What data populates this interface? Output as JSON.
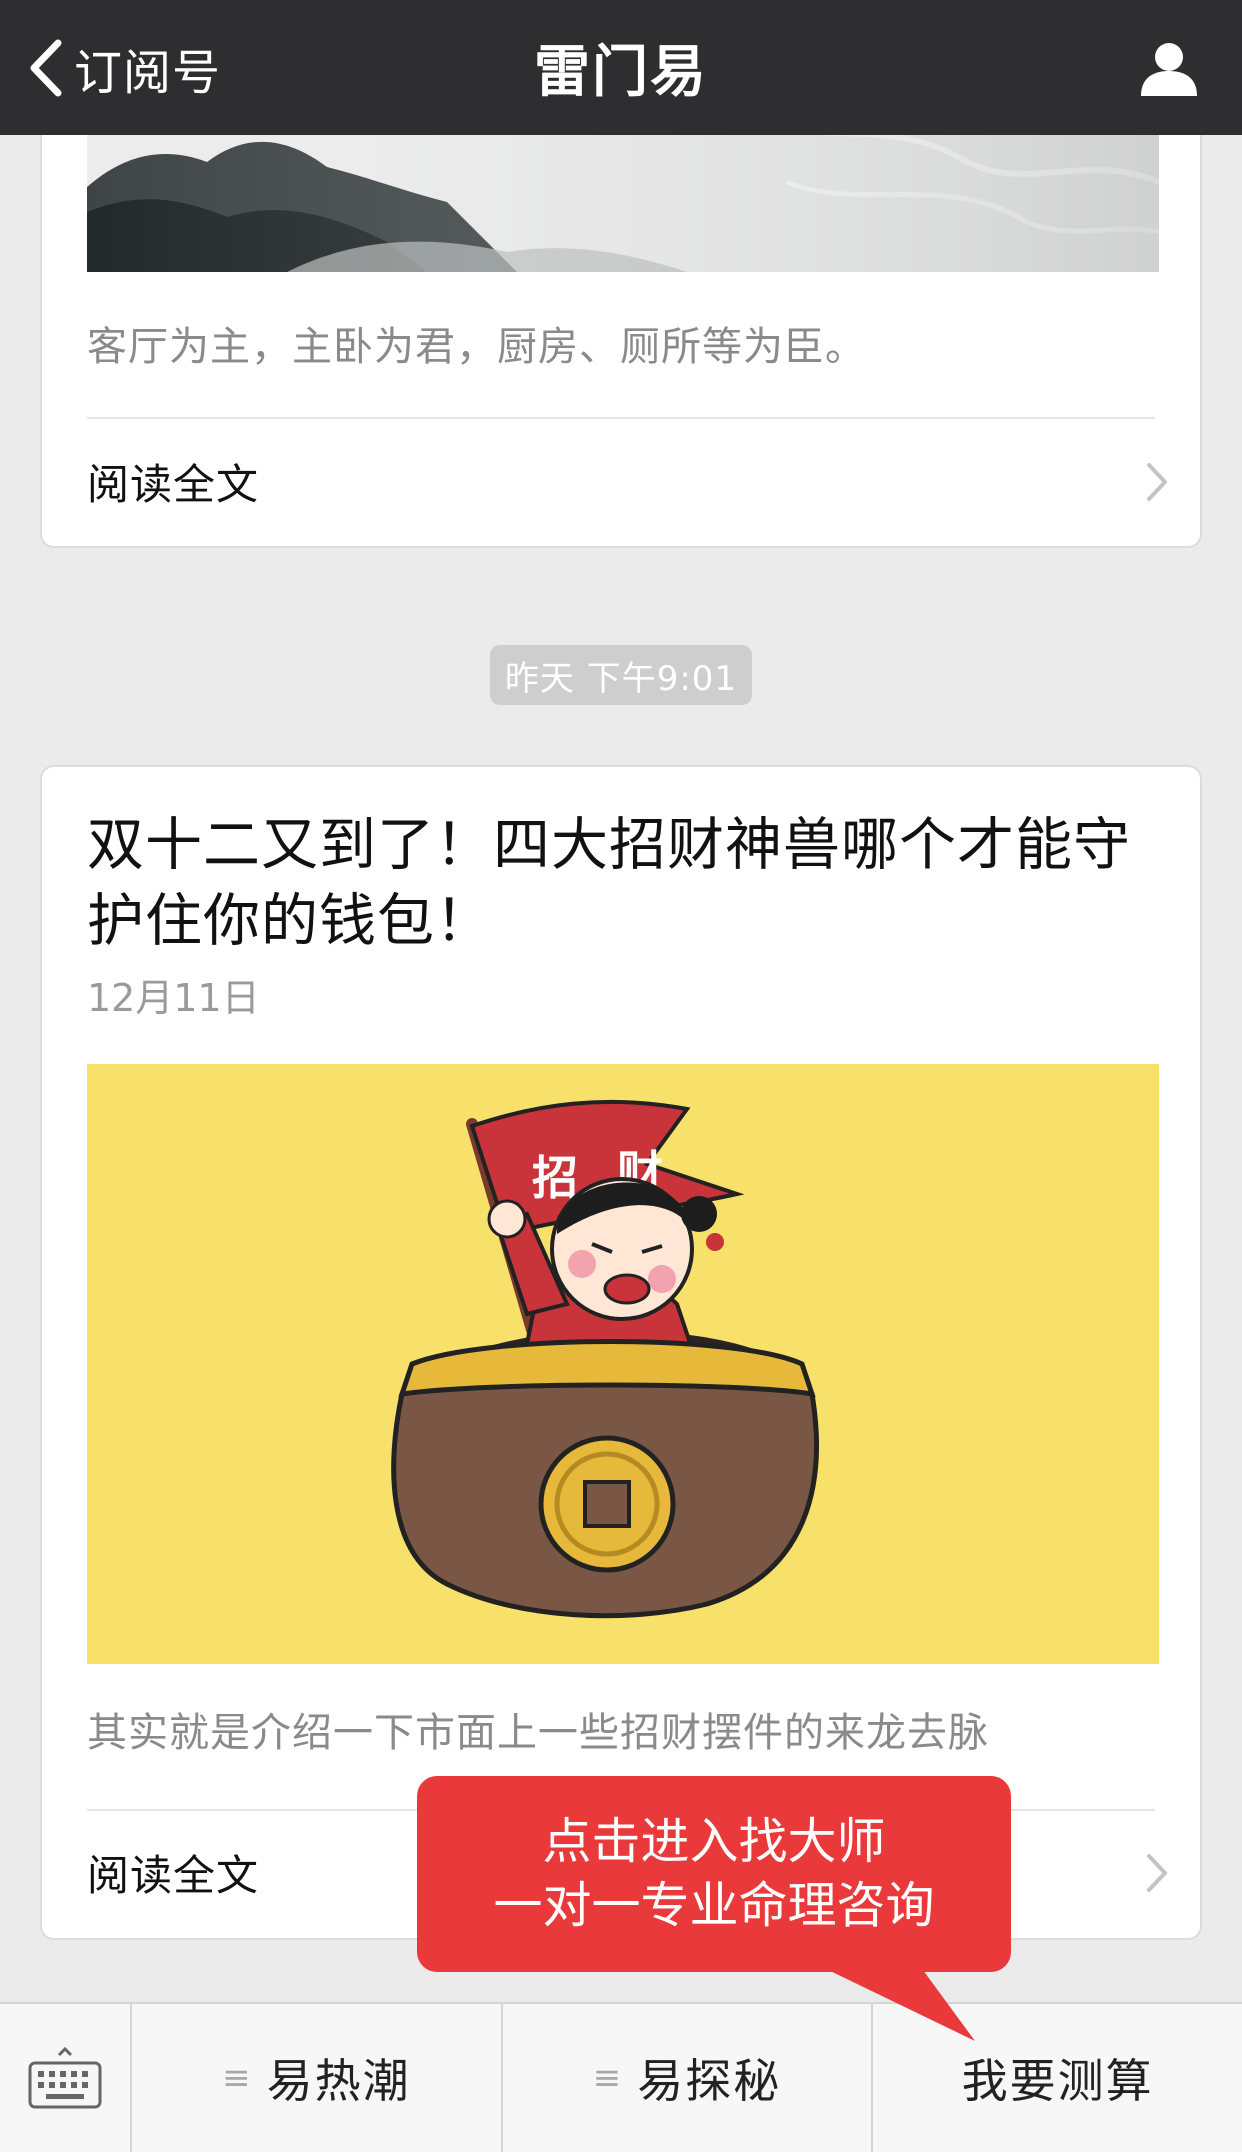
{
  "navbar": {
    "back_label": "订阅号",
    "title": "雷门易",
    "profile_icon": "person-icon"
  },
  "article_previous": {
    "summary": "客厅为主，主卧为君，厨房、厕所等为臣。",
    "read_more": "阅读全文"
  },
  "timestamp": "昨天 下午9:01",
  "article_main": {
    "title": "双十二又到了！四大招财神兽哪个才能守护住你的钱包！",
    "date": "12月11日",
    "cover_flag_text": [
      "招",
      "财"
    ],
    "summary": "其实就是介绍一下市面上一些招财摆件的来龙去脉",
    "read_more": "阅读全文"
  },
  "callout": {
    "line1": "点击进入找大师",
    "line2": "一对一专业命理咨询"
  },
  "menu": {
    "keyboard_icon": "keyboard-icon",
    "items": [
      {
        "label": "易热潮",
        "has_submenu": true
      },
      {
        "label": "易探秘",
        "has_submenu": true
      },
      {
        "label": "我要测算",
        "has_submenu": false
      }
    ],
    "submenu_glyph": "≡"
  },
  "colors": {
    "navbar_bg": "#2e2e30",
    "callout_red": "#e9393a",
    "cover_yellow": "#f7e16a"
  }
}
